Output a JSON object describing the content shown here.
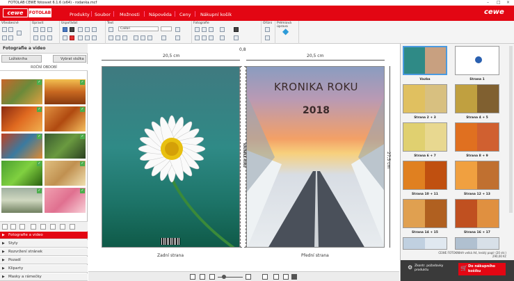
{
  "window": {
    "title": "FOTOLAB CEWE fotosvet 6.1.6 (x64) - rodanka.mcf"
  },
  "brand": {
    "logo_text": "cewe",
    "logo2_text": "FOTOLAB",
    "right_logo": "cewe",
    "accent": "#e30613"
  },
  "menu": {
    "items": [
      "Produkty",
      "Soubor",
      "Možnosti",
      "Nápověda",
      "Ceny",
      "Nákupní košík"
    ]
  },
  "ribbon": {
    "groups": [
      "Všeobecné",
      "Úpravit",
      "Uspořádat",
      "Text",
      "Fotografie",
      "Ořízni",
      "Prémiová úprava"
    ],
    "font_value": "Calibri",
    "premium_label": "Prémiová úprava"
  },
  "sidebar": {
    "title": "Fotografie a video",
    "btn_folder": "Ložiskniha",
    "btn_select": "Vybrat složka",
    "folder_label": "ROČNÍ OBDOBÍ",
    "sections": [
      "Fotografie a video",
      "Styly",
      "Rozvržení stránek",
      "Pozadí",
      "Kliparty",
      "Masky a rámečky"
    ]
  },
  "canvas": {
    "dim_back": "20,5 cm",
    "dim_spine": "0,8",
    "dim_front": "20,5 cm",
    "dim_height": "27,5 cm",
    "spine_text": "KRONIKA ROKU",
    "cover_title": "KRONIKA ROKU",
    "cover_year": "2018",
    "back_label": "Zadní strana",
    "front_label": "Přední strana"
  },
  "pages": [
    {
      "label": "Vazba"
    },
    {
      "label": "Strana 1"
    },
    {
      "label": "Strana 2 + 3"
    },
    {
      "label": "Strana 4 + 5"
    },
    {
      "label": "Strana 6 + 7"
    },
    {
      "label": "Strana 8 + 9"
    },
    {
      "label": "Strana 10 + 11"
    },
    {
      "label": "Strana 12 + 13"
    },
    {
      "label": "Strana 14 + 15"
    },
    {
      "label": "Strana 16 + 17"
    }
  ],
  "rightpanel": {
    "info": "CEWE FOTOKNIHA velká A4, lesklý papír (20 str.)",
    "price": "290,00 Kč",
    "btn_check": "Zkontr. požadavky produktu",
    "btn_cart": "Do nákupního košíku"
  }
}
